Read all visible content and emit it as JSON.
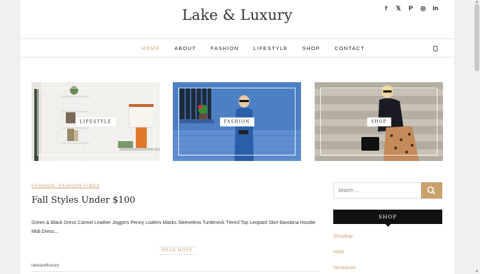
{
  "site": {
    "title": "Lake & Luxury"
  },
  "social": [
    {
      "icon": "facebook-icon",
      "glyph": "f"
    },
    {
      "icon": "twitter-icon",
      "glyph": "𝕏"
    },
    {
      "icon": "pinterest-icon",
      "glyph": "P"
    },
    {
      "icon": "instagram-icon",
      "glyph": "◎"
    },
    {
      "icon": "linkedin-icon",
      "glyph": "in"
    }
  ],
  "nav": {
    "items": [
      {
        "label": "HOME",
        "active": true
      },
      {
        "label": "ABOUT",
        "active": false
      },
      {
        "label": "FASHION",
        "active": false
      },
      {
        "label": "LIFESTYLE",
        "active": false
      },
      {
        "label": "SHOP",
        "active": false
      },
      {
        "label": "CONTACT",
        "active": false
      }
    ]
  },
  "cards": [
    {
      "label": "LIFESTYLE"
    },
    {
      "label": "FASHION"
    },
    {
      "label": "SHOP"
    }
  ],
  "post": {
    "categories": "FASHION, FASHION FINDS",
    "title": "Fall Styles Under $100",
    "excerpt": "Green & Black Dress Carmel Leather Joggers Penny Loafers Masks Sleeveless Turtleneck Tiered Top Leopard Skirt Bandana Hoodie Midi Dress…",
    "read_more": "READ MORE",
    "author": "lakeandluxury"
  },
  "sidebar": {
    "search_placeholder": "Search ...",
    "shop_heading": "SHOP",
    "shop_links": [
      "Shopbop",
      "H&M",
      "Nordstrom"
    ]
  },
  "colors": {
    "accent": "#c9a26d",
    "dark": "#111111"
  }
}
